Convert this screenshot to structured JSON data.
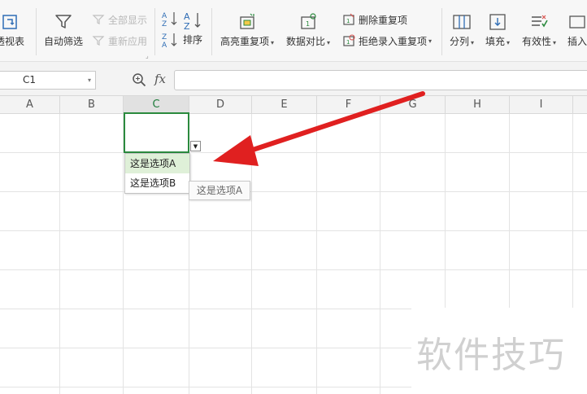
{
  "ribbon": {
    "pivot_label": "透视表",
    "autofilter_label": "自动筛选",
    "show_all_label": "全部显示",
    "reapply_label": "重新应用",
    "sort_label": "排序",
    "highlight_dup_label": "高亮重复项",
    "compare_label": "数据对比",
    "remove_dup_label": "删除重复项",
    "reject_dup_label": "拒绝录入重复项",
    "split_label": "分列",
    "fill_label": "填充",
    "validity_label": "有效性",
    "insert_label": "插入"
  },
  "formula_bar": {
    "name_box": "C1",
    "fx": "fx",
    "formula": ""
  },
  "columns": [
    "A",
    "B",
    "C",
    "D",
    "E",
    "F",
    "G",
    "H",
    "I"
  ],
  "dropdown": {
    "options": [
      "这是选项A",
      "这是选项B"
    ],
    "tooltip": "这是选项A"
  },
  "watermark": "软件技巧",
  "colors": {
    "accent": "#2b8a3e",
    "arrow": "#e02020",
    "hover": "#dff0d8"
  }
}
